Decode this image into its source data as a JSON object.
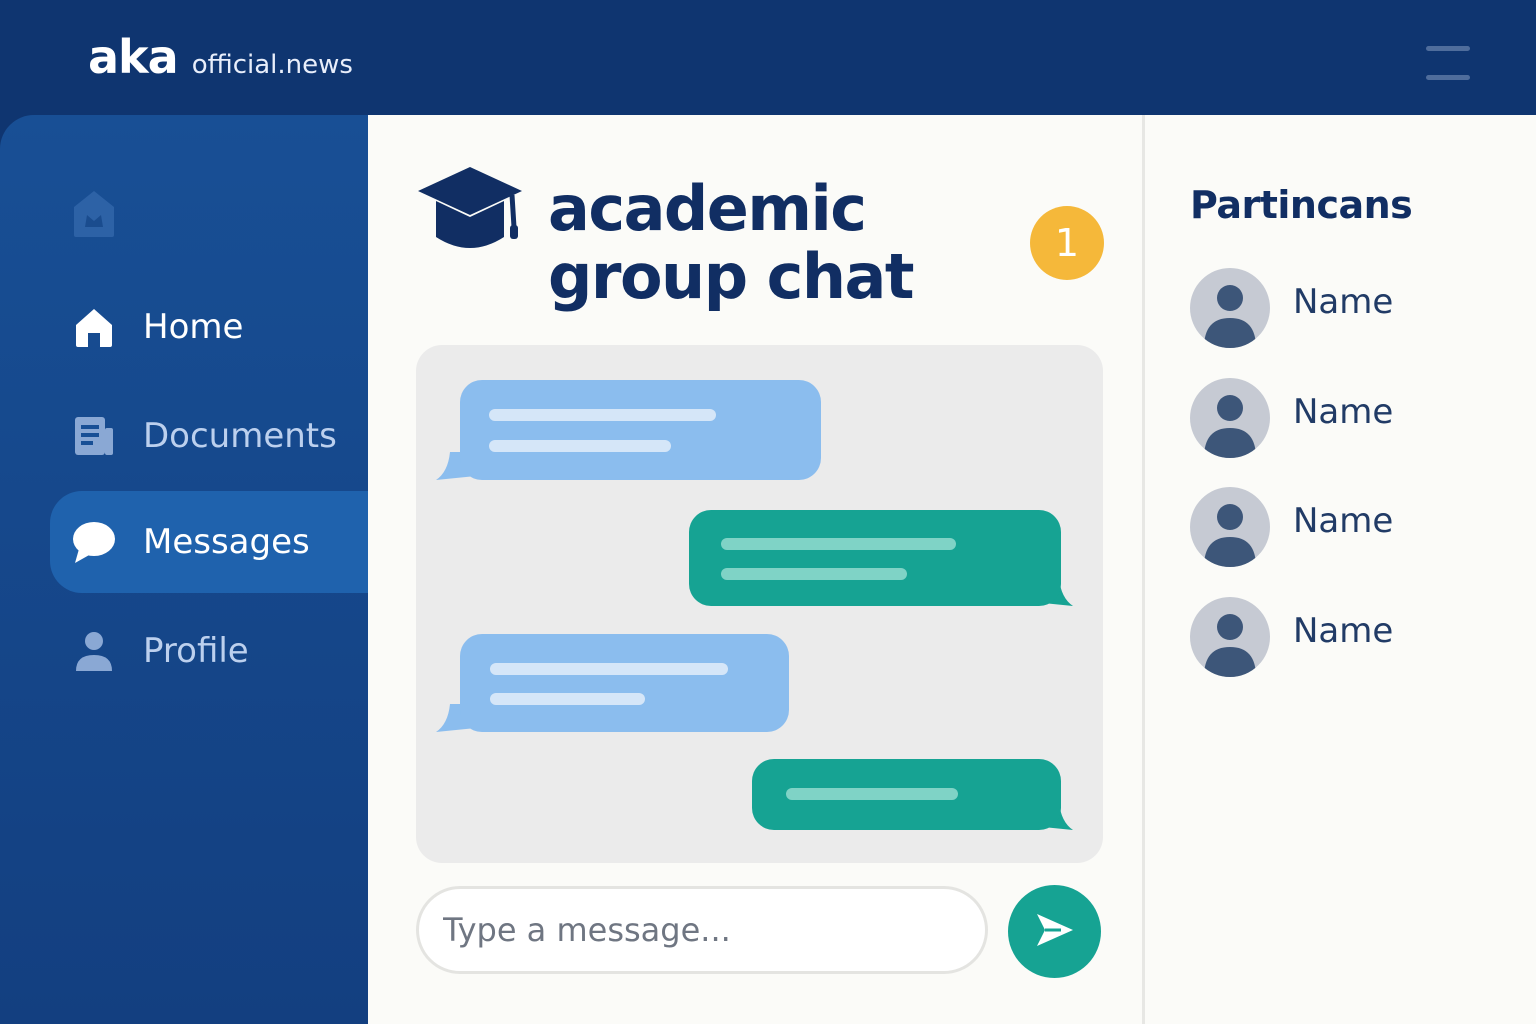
{
  "header": {
    "brand_main": "aka",
    "brand_sub": "official.news",
    "menu_icon": "hamburger-menu-icon"
  },
  "sidebar": {
    "logo_icon": "school-logo-icon",
    "items": [
      {
        "label": "Home",
        "icon": "home-icon",
        "active": false
      },
      {
        "label": "Documents",
        "icon": "document-icon",
        "active": false
      },
      {
        "label": "Messages",
        "icon": "chat-bubble-icon",
        "active": true
      },
      {
        "label": "Profile",
        "icon": "user-icon",
        "active": false
      }
    ]
  },
  "main": {
    "title_line1": "academic",
    "title_line2": "group chat",
    "title_icon": "graduation-cap-icon",
    "unread_count": "1",
    "messages": [
      {
        "direction": "incoming",
        "text_lines": 2
      },
      {
        "direction": "outgoing",
        "text_lines": 2
      },
      {
        "direction": "incoming",
        "text_lines": 2
      },
      {
        "direction": "outgoing",
        "text_lines": 1
      }
    ],
    "input_placeholder": "Type a message...",
    "send_icon": "send-icon"
  },
  "participants": {
    "title": "Partincans",
    "list": [
      {
        "name": "Name"
      },
      {
        "name": "Name"
      },
      {
        "name": "Name"
      },
      {
        "name": "Name"
      }
    ]
  },
  "colors": {
    "header_bg": "#0f3570",
    "sidebar_bg": "#184f95",
    "active_nav": "#1f62ad",
    "incoming_bubble": "#8bbdee",
    "outgoing_bubble": "#16a393",
    "badge": "#f5b83a",
    "title_text": "#112e63"
  }
}
